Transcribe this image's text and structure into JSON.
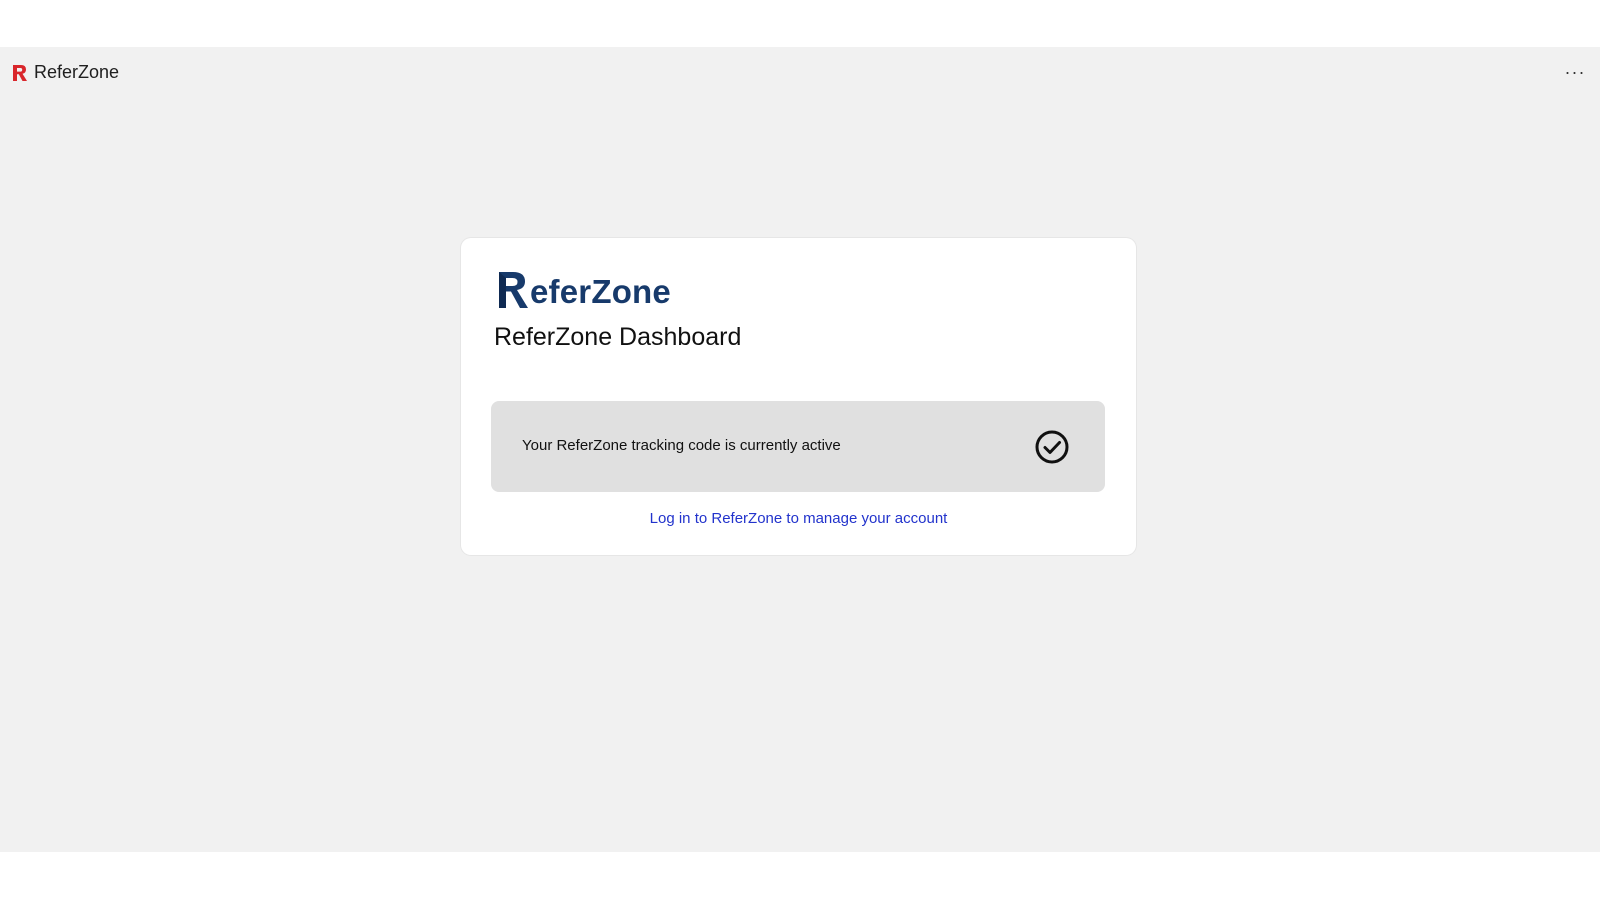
{
  "window": {
    "title": "ReferZone",
    "icon": "referzone-r-icon",
    "more_label": "···"
  },
  "card": {
    "logo_text": "eferZone",
    "title": "ReferZone Dashboard",
    "status_text": "Your ReferZone tracking code is currently active",
    "status_icon": "check-circle-icon",
    "link_text": "Log in to ReferZone to manage your account"
  },
  "colors": {
    "brand_red": "#d9262b",
    "brand_navy": "#173a6b",
    "link_blue": "#2233cc",
    "status_bg": "#e0e0e0",
    "app_bg": "#f1f1f1"
  }
}
